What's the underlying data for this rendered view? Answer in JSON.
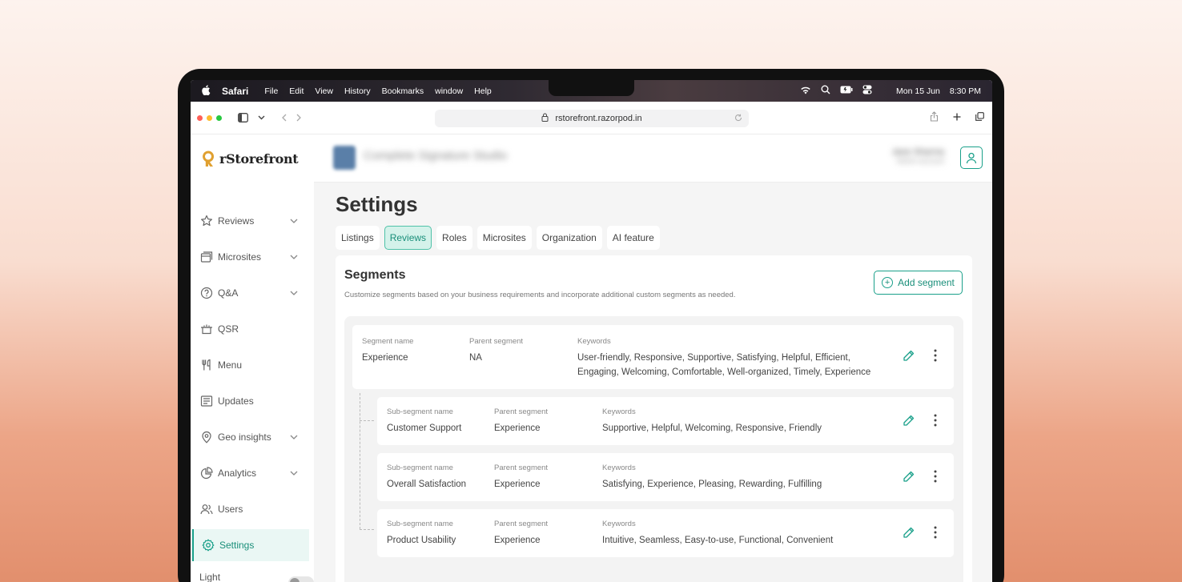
{
  "menubar": {
    "apple": "",
    "app_name": "Safari",
    "menus": [
      "File",
      "Edit",
      "View",
      "History",
      "Bookmarks",
      "window",
      "Help"
    ],
    "date": "Mon 15 Jun",
    "time": "8:30 PM"
  },
  "browser": {
    "url": "rstorefront.razorpod.in"
  },
  "brand": {
    "name": "rStorefront"
  },
  "header": {
    "store_name": "Complete Signature Studio",
    "user_name": "Jane Sharma",
    "user_sub": "Admin account"
  },
  "sidebar": {
    "items": [
      {
        "label": "Reviews",
        "icon": "star-icon",
        "chevron": true
      },
      {
        "label": "Microsites",
        "icon": "microsites-icon",
        "chevron": true
      },
      {
        "label": "Q&A",
        "icon": "question-icon",
        "chevron": true
      },
      {
        "label": "QSR",
        "icon": "pot-icon",
        "chevron": false
      },
      {
        "label": "Menu",
        "icon": "fork-knife-icon",
        "chevron": false
      },
      {
        "label": "Updates",
        "icon": "newspaper-icon",
        "chevron": false
      },
      {
        "label": "Geo insights",
        "icon": "map-pin-icon",
        "chevron": true
      },
      {
        "label": "Analytics",
        "icon": "chart-pie-icon",
        "chevron": true
      },
      {
        "label": "Users",
        "icon": "users-icon",
        "chevron": false
      },
      {
        "label": "Settings",
        "icon": "gear-icon",
        "chevron": false
      }
    ],
    "light_mode_label": "Light mode"
  },
  "page": {
    "title": "Settings",
    "tabs": [
      "Listings",
      "Reviews",
      "Roles",
      "Microsites",
      "Organization",
      "AI feature"
    ],
    "active_tab": "Reviews"
  },
  "segments": {
    "title": "Segments",
    "description": "Customize segments based on your business requirements and incorporate additional custom segments as needed.",
    "add_label": "Add segment",
    "main": {
      "name_label": "Segment name",
      "name": "Experience",
      "parent_label": "Parent segment",
      "parent": "NA",
      "keywords_label": "Keywords",
      "keywords_line1": "User-friendly, Responsive, Supportive, Satisfying, Helpful, Efficient,",
      "keywords_line2": "Engaging, Welcoming, Comfortable, Well-organized, Timely, Experience"
    },
    "subs": [
      {
        "name_label": "Sub-segment name",
        "name": "Customer Support",
        "parent_label": "Parent segment",
        "parent": "Experience",
        "keywords_label": "Keywords",
        "keywords": "Supportive, Helpful, Welcoming, Responsive, Friendly"
      },
      {
        "name_label": "Sub-segment name",
        "name": "Overall Satisfaction",
        "parent_label": "Parent segment",
        "parent": "Experience",
        "keywords_label": "Keywords",
        "keywords": "Satisfying, Experience, Pleasing, Rewarding, Fulfilling"
      },
      {
        "name_label": "Sub-segment name",
        "name": "Product Usability",
        "parent_label": "Parent segment",
        "parent": "Experience",
        "keywords_label": "Keywords",
        "keywords": "Intuitive, Seamless, Easy-to-use, Functional, Convenient"
      }
    ]
  },
  "colors": {
    "accent": "#1aa08a",
    "accent_light": "#d4f2ea",
    "brand_gold": "#e0a030"
  }
}
